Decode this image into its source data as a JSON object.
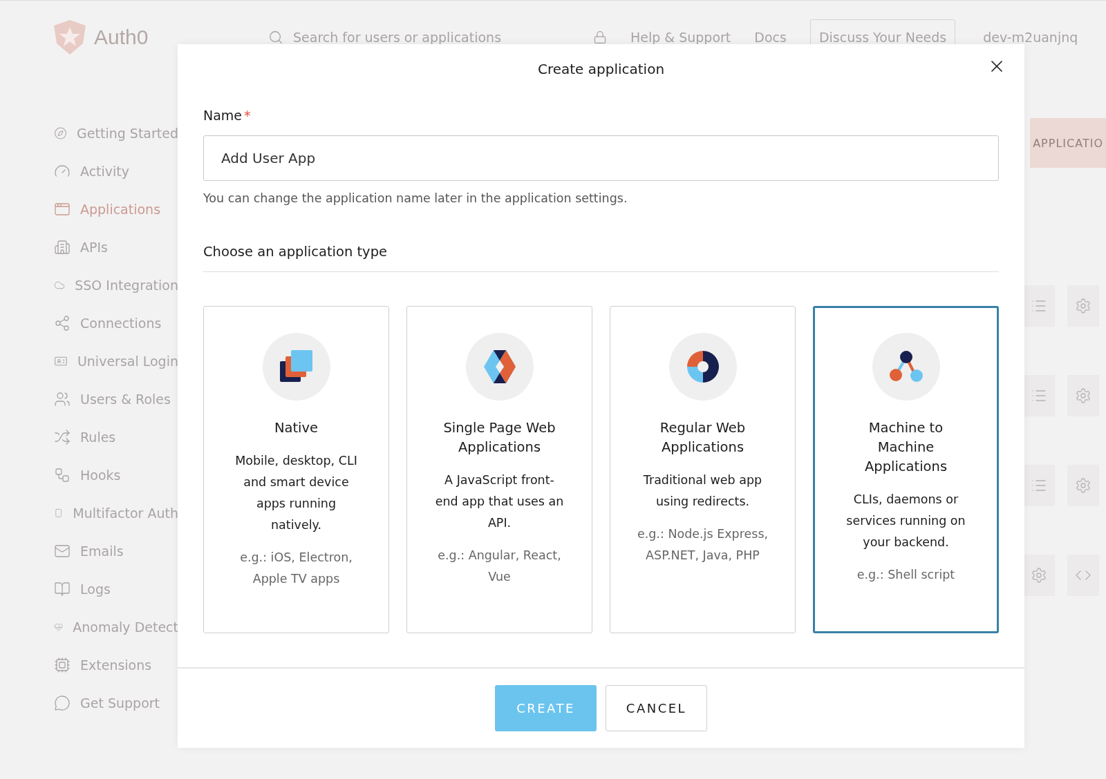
{
  "header": {
    "logo": "Auth0",
    "search_placeholder": "Search for users or applications",
    "links": [
      "Help & Support",
      "Docs"
    ],
    "discuss_button": "Discuss Your Needs",
    "tenant": "dev-m2uanjnq"
  },
  "sidebar": {
    "items": [
      {
        "label": "Getting Started",
        "selected": false
      },
      {
        "label": "Activity",
        "selected": false
      },
      {
        "label": "Applications",
        "selected": true
      },
      {
        "label": "APIs",
        "selected": false
      },
      {
        "label": "SSO Integration",
        "selected": false
      },
      {
        "label": "Connections",
        "selected": false
      },
      {
        "label": "Universal Login",
        "selected": false
      },
      {
        "label": "Users & Roles",
        "selected": false
      },
      {
        "label": "Rules",
        "selected": false
      },
      {
        "label": "Hooks",
        "selected": false
      },
      {
        "label": "Multifactor Auth",
        "selected": false
      },
      {
        "label": "Emails",
        "selected": false
      },
      {
        "label": "Logs",
        "selected": false
      },
      {
        "label": "Anomaly Detect",
        "selected": false
      },
      {
        "label": "Extensions",
        "selected": false
      },
      {
        "label": "Get Support",
        "selected": false
      }
    ]
  },
  "main": {
    "create_button": "APPLICATIO",
    "rows": [
      {
        "kind": "app"
      },
      {
        "kind": "app"
      },
      {
        "kind": "app"
      },
      {
        "kind": "api"
      }
    ]
  },
  "dialog": {
    "title": "Create application",
    "name_label": "Name",
    "required_mark": "*",
    "name_value": "Add User App",
    "hint": "You can change the application name later in the application settings.",
    "section_title": "Choose an application type",
    "types": [
      {
        "kind": "native",
        "title": "Native",
        "description": "Mobile, desktop, CLI and smart device apps running natively.",
        "examples": "e.g.: iOS, Electron, Apple TV apps",
        "selected": false
      },
      {
        "kind": "spa",
        "title": "Single Page Web Applications",
        "description": "A JavaScript front-end app that uses an API.",
        "examples": "e.g.: Angular, React, Vue",
        "selected": false
      },
      {
        "kind": "web",
        "title": "Regular Web Applications",
        "description": "Traditional web app using redirects.",
        "examples": "e.g.: Node.js Express, ASP.NET, Java, PHP",
        "selected": false
      },
      {
        "kind": "m2m",
        "title": "Machine to Machine Applications",
        "description": "CLIs, daemons or services running on your backend.",
        "examples": "e.g.: Shell script",
        "selected": true
      }
    ],
    "create_button": "CREATE",
    "cancel_button": "CANCEL"
  }
}
